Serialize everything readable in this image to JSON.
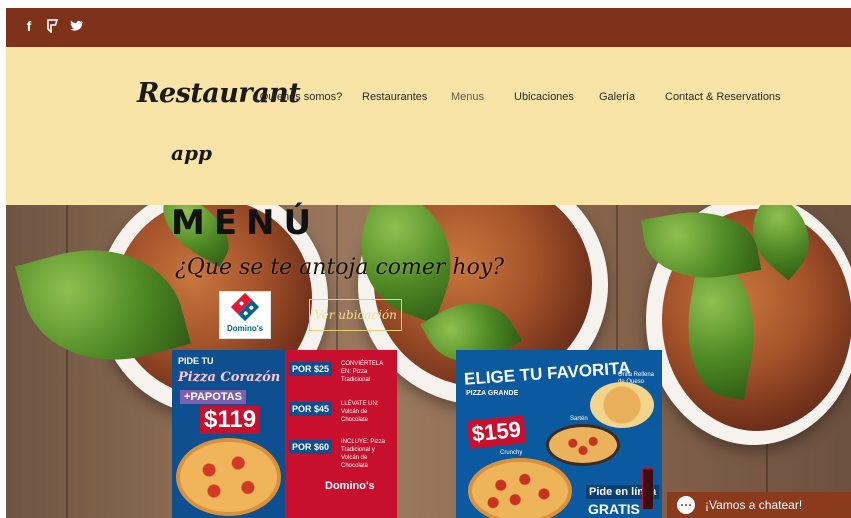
{
  "topbar": {
    "social_icons": [
      "facebook-icon",
      "foursquare-icon",
      "twitter-icon",
      "instagram-icon"
    ]
  },
  "header": {
    "logo_line1": "Restaurant",
    "logo_line2": "app",
    "nav": [
      {
        "label": "¿Quienes somos?"
      },
      {
        "label": "Restaurantes"
      },
      {
        "label": "Menus"
      },
      {
        "label": "Ubicaciones"
      },
      {
        "label": "Galería"
      },
      {
        "label": "Contact & Reservations"
      }
    ]
  },
  "hero": {
    "title": "MENÚ",
    "tagline": "¿Que se te antoja comer hoy?",
    "dominos_label": "Domino's",
    "button": "Ver ubicación"
  },
  "promo1": {
    "pide_tu": "PIDE TU",
    "pizza_corazon": "Pizza Corazón",
    "papotas": "+PAPOTAS",
    "price": "$119",
    "offers": [
      {
        "price": "POR $25",
        "desc": "CONVIÉRTELA EN: Pizza Tradicional"
      },
      {
        "price": "POR $45",
        "desc": "LLÉVATE UN: Volcán de Chocolate"
      },
      {
        "price": "POR $60",
        "desc": "INCLUYE: Pizza Tradicional y Volcán de Chocolate"
      }
    ],
    "brand": "Domino's"
  },
  "promo2": {
    "headline": "ELIGE TU FAVORITA",
    "sub": "PIZZA GRANDE",
    "price": "$159",
    "crunchy": "Crunchy",
    "sarten": "Sartén",
    "orilla": "Orilla Rellena de Queso",
    "pide": "Pide en línea",
    "gratis": "GRATIS"
  },
  "chat": {
    "label": "¡Vamos a chatear!"
  },
  "colors": {
    "topbar": "#7e3219",
    "header_bg": "#f7e4a6",
    "button_border": "#e9d077",
    "chat_bg": "#8b3a1c"
  }
}
